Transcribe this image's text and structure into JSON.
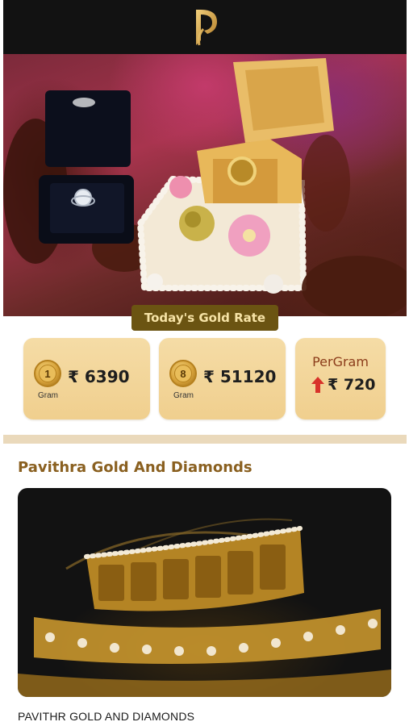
{
  "brand": {
    "logo_icon": "pavithra-p-logo-icon",
    "accent": "#d9a441",
    "topbar_bg": "#121212"
  },
  "hero": {
    "image_icon": "jewelry-ring-boxes-photo"
  },
  "gold_rate": {
    "badge_label": "Today's Gold Rate",
    "cards": [
      {
        "coin": "1",
        "amount": "₹ 6390",
        "unit": "Gram"
      },
      {
        "coin": "8",
        "amount": "₹ 51120",
        "unit": "Gram"
      }
    ],
    "per_gram": {
      "label": "PerGram",
      "amount": "₹ 720",
      "trend_icon": "arrow-up-icon",
      "trend_color": "#d8322a"
    }
  },
  "featured": {
    "section_title": "Pavithra Gold And Diamonds",
    "image_icon": "gold-necklace-photo",
    "caption": "PAVITHR GOLD AND DIAMONDS"
  }
}
